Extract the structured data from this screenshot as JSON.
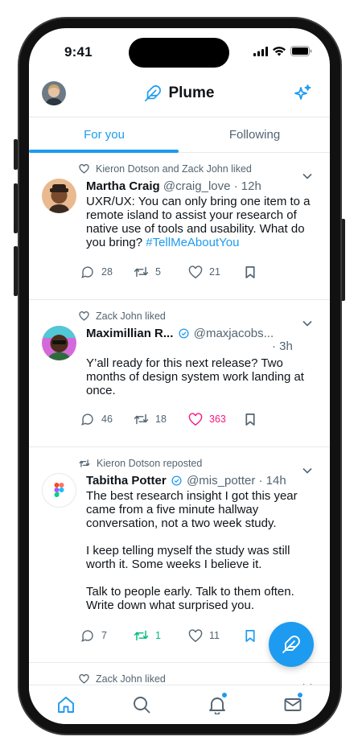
{
  "status_bar": {
    "time": "9:41"
  },
  "header": {
    "brand": "Plume"
  },
  "tabs": [
    {
      "label": "For you",
      "active": true
    },
    {
      "label": "Following",
      "active": false
    }
  ],
  "posts": [
    {
      "context": "Kieron Dotson and Zack John liked",
      "context_type": "like",
      "name": "Martha Craig",
      "handle": "@craig_love",
      "time": "· 12h",
      "verified": false,
      "text": "UXR/UX: You can only bring one item to a remote island to assist your research of native use of tools and usability. What do you bring?",
      "hashtag": "#TellMeAboutYou",
      "replies": "28",
      "reposts": "5",
      "likes": "21",
      "liked": false,
      "bookmarked": false
    },
    {
      "context": "Zack John liked",
      "context_type": "like",
      "name": "Maximillian R...",
      "handle": "@maxjacobs...",
      "time": "· 3h",
      "verified": true,
      "text": "Y’all ready for this next release? Two months of design system work landing at once.",
      "replies": "46",
      "reposts": "18",
      "likes": "363",
      "liked": true,
      "bookmarked": false
    },
    {
      "context": "Kieron Dotson reposted",
      "context_type": "repost",
      "name": "Tabitha Potter",
      "handle": "@mis_potter",
      "time": "· 14h",
      "verified": true,
      "paragraphs": [
        "The best research insight I got this year came from a five minute hallway conversation, not a two week study.",
        "I keep telling myself the study was still worth it. Some weeks I believe it.",
        "Talk to people early. Talk to them often. Write down what surprised you."
      ],
      "replies": "7",
      "reposts": "1",
      "likes": "11",
      "reposted": true,
      "bookmarked": true
    },
    {
      "context": "Zack John liked",
      "context_type": "like"
    }
  ],
  "colors": {
    "accent": "#1d9bf0",
    "like": "#f91880",
    "repost": "#00ba7c",
    "muted": "#536471",
    "text": "#0f1419",
    "divider": "#e6e9eb"
  },
  "icons": {
    "header": [
      "avatar",
      "feather-icon",
      "sparkle-icon"
    ],
    "nav": [
      "home-icon",
      "search-icon",
      "bell-icon",
      "mail-icon"
    ],
    "fab": "feather-icon"
  }
}
